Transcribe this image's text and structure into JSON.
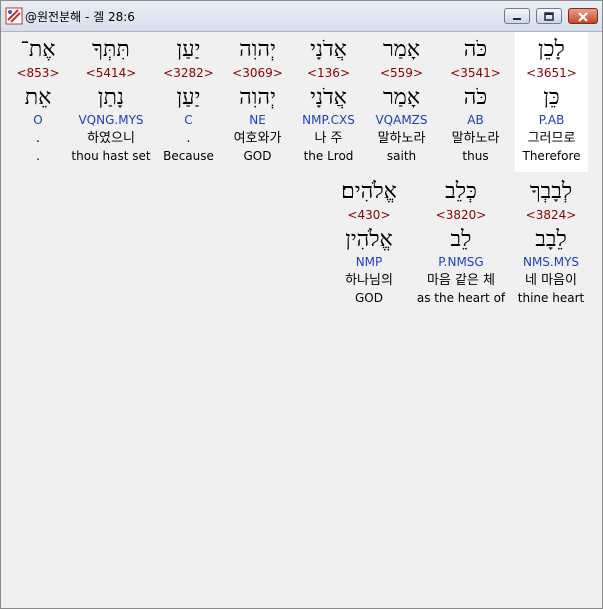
{
  "window": {
    "title": "@원전분해 - 겔 28:6"
  },
  "colors": {
    "strong": "#8b0000",
    "morph": "#1e3fbf"
  },
  "rows": [
    {
      "words": [
        {
          "hebrew": "לָכֵן",
          "strong": "<3651>",
          "lemma": "כֵּן",
          "morph": "P.AB",
          "korean": "그러므로",
          "english": "Therefore",
          "highlight": true
        },
        {
          "hebrew": "כֹּה",
          "strong": "<3541>",
          "lemma": "כֹּה",
          "morph": "AB",
          "korean": "말하노라",
          "english": "thus"
        },
        {
          "hebrew": "אָמַר",
          "strong": "<559>",
          "lemma": "אָמַר",
          "morph": "VQAMZS",
          "korean": "말하노라",
          "english": "saith"
        },
        {
          "hebrew": "אֲדֹנָי",
          "strong": "<136>",
          "lemma": "אֲדֹנָי",
          "morph": "NMP.CXS",
          "korean": "나 주",
          "english": "the Lrod"
        },
        {
          "hebrew": "יְהוִה",
          "strong": "<3069>",
          "lemma": "יְהוִה",
          "morph": "NE",
          "korean": "여호와가",
          "english": "GOD"
        },
        {
          "hebrew": "יַעַן",
          "strong": "<3282>",
          "lemma": "יַעַן",
          "morph": "C",
          "korean": ".",
          "english": "Because"
        },
        {
          "hebrew": "תִּתְּךָ",
          "strong": "<5414>",
          "lemma": "נָתַן",
          "morph": "VQNG.MYS",
          "korean": "하였으니",
          "english": "thou hast set"
        },
        {
          "hebrew": "אֶת־",
          "strong": "<853>",
          "lemma": "אֵת",
          "morph": "O",
          "korean": ".",
          "english": "."
        }
      ]
    },
    {
      "words": [
        {
          "hebrew": "לְבָבְךָ",
          "strong": "<3824>",
          "lemma": "לֵבָב",
          "morph": "NMS.MYS",
          "korean": "네 마음이",
          "english": "thine heart"
        },
        {
          "hebrew": "כְּלֵב",
          "strong": "<3820>",
          "lemma": "לֵב",
          "morph": "P.NMSG",
          "korean": "마음 같은 체",
          "english": "as the heart of"
        },
        {
          "hebrew": "אֱלֹהִים׃",
          "strong": "<430>",
          "lemma": "אֱלֹהִין",
          "morph": "NMP",
          "korean": "하나님의",
          "english": "GOD"
        }
      ]
    }
  ]
}
